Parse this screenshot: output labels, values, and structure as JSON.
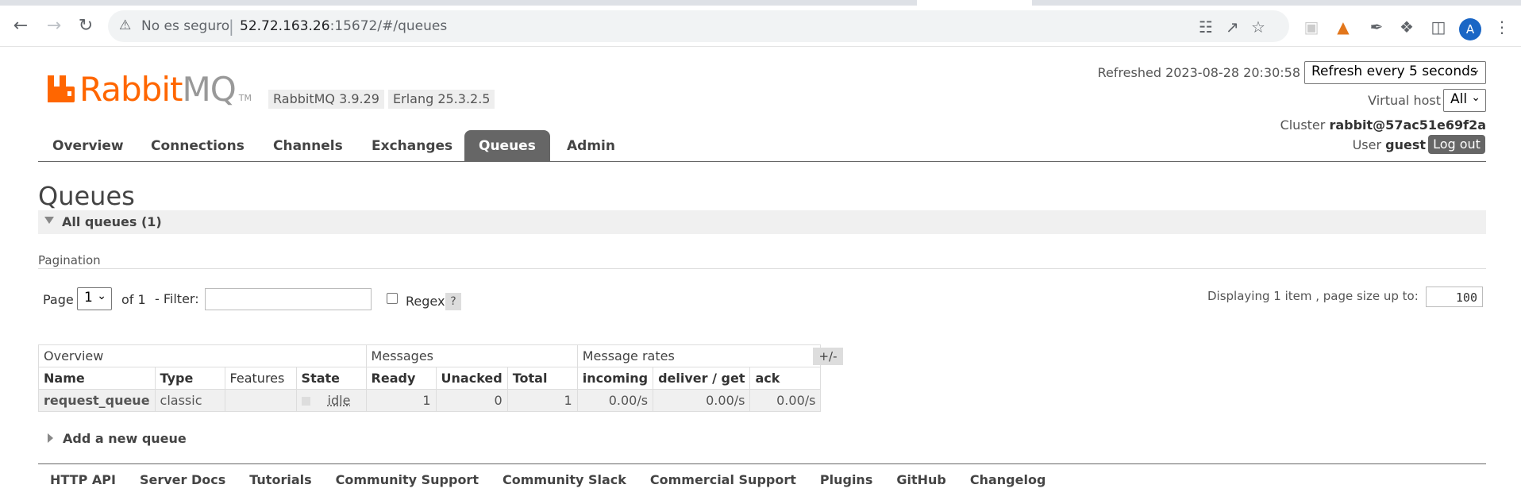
{
  "browser": {
    "security_label": "No es seguro",
    "url_host": "52.72.163.26",
    "url_path": ":15672/#/queues",
    "avatar_letter": "A"
  },
  "header": {
    "logo_rabbit": "Rabbit",
    "logo_mq": "MQ",
    "logo_tm": "TM",
    "version": "RabbitMQ 3.9.29",
    "erlang": "Erlang 25.3.2.5",
    "refreshed_label": "Refreshed 2023-08-28 20:30:58",
    "refresh_select": "Refresh every 5 seconds",
    "vhost_label": "Virtual host",
    "vhost_select": "All",
    "cluster_label": "Cluster",
    "cluster_name": "rabbit@57ac51e69f2a",
    "user_label": "User",
    "user_name": "guest",
    "logout": "Log out"
  },
  "tabs": [
    {
      "label": "Overview"
    },
    {
      "label": "Connections"
    },
    {
      "label": "Channels"
    },
    {
      "label": "Exchanges"
    },
    {
      "label": "Queues"
    },
    {
      "label": "Admin"
    }
  ],
  "page": {
    "title": "Queues",
    "section_title": "All queues (1)",
    "pagination_label": "Pagination",
    "page_label": "Page",
    "page_value": "1",
    "of_label": "of 1",
    "filter_label": "- Filter:",
    "regex_label": "Regex",
    "help_label": "?",
    "displaying_label": "Displaying 1 item , page size up to:",
    "page_size": "100",
    "plusminus": "+/-",
    "add_queue": "Add a new queue"
  },
  "table": {
    "groups": [
      "Overview",
      "Messages",
      "Message rates"
    ],
    "columns": [
      "Name",
      "Type",
      "Features",
      "State",
      "Ready",
      "Unacked",
      "Total",
      "incoming",
      "deliver / get",
      "ack"
    ],
    "rows": [
      {
        "name": "request_queue",
        "type": "classic",
        "features": "",
        "state": "idle",
        "ready": "1",
        "unacked": "0",
        "total": "1",
        "incoming": "0.00/s",
        "deliver_get": "0.00/s",
        "ack": "0.00/s"
      }
    ]
  },
  "footer": [
    "HTTP API",
    "Server Docs",
    "Tutorials",
    "Community Support",
    "Community Slack",
    "Commercial Support",
    "Plugins",
    "GitHub",
    "Changelog"
  ],
  "colors": {
    "brand": "#ff6600",
    "tab_active": "#666666"
  }
}
